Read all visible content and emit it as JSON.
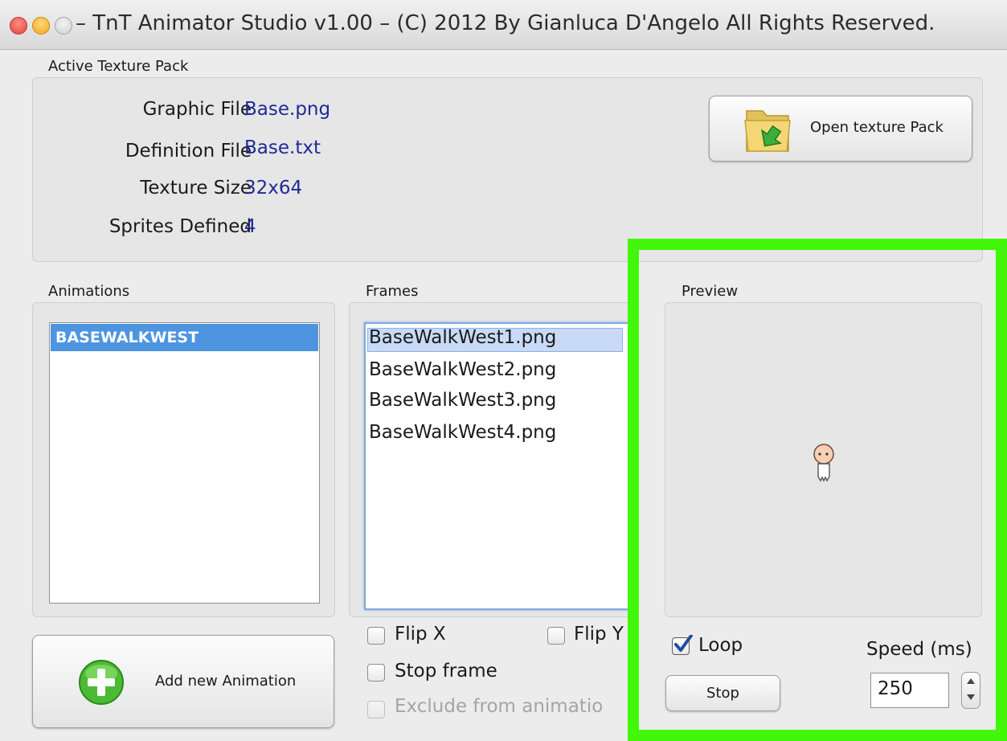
{
  "window": {
    "title": "– TnT Animator Studio v1.00 – (C) 2012 By Gianluca D'Angelo All Rights Reserved."
  },
  "texture_pack": {
    "group_label": "Active Texture Pack",
    "fields": [
      {
        "label": "Graphic File",
        "value": "Base.png"
      },
      {
        "label": "Definition File",
        "value": "Base.txt"
      },
      {
        "label": "Texture Size",
        "value": "32x64"
      },
      {
        "label": "Sprites Defined",
        "value": "4"
      }
    ],
    "open_button": "Open texture Pack"
  },
  "animations": {
    "group_label": "Animations",
    "items": [
      "BASEWALKWEST"
    ],
    "add_button": "Add new Animation"
  },
  "frames": {
    "group_label": "Frames",
    "items": [
      "BaseWalkWest1.png",
      "BaseWalkWest2.png",
      "BaseWalkWest3.png",
      "BaseWalkWest4.png"
    ],
    "flip_x": "Flip X",
    "flip_y": "Flip Y",
    "stop_frame": "Stop frame",
    "exclude": "Exclude from animatio"
  },
  "preview": {
    "group_label": "Preview",
    "loop_label": "Loop",
    "loop_checked": true,
    "speed_label": "Speed (ms)",
    "speed_value": "250",
    "stop_button": "Stop"
  },
  "colors": {
    "highlight": "#42f70a",
    "selection": "#4d95e0",
    "value_text": "#1f2a96"
  }
}
